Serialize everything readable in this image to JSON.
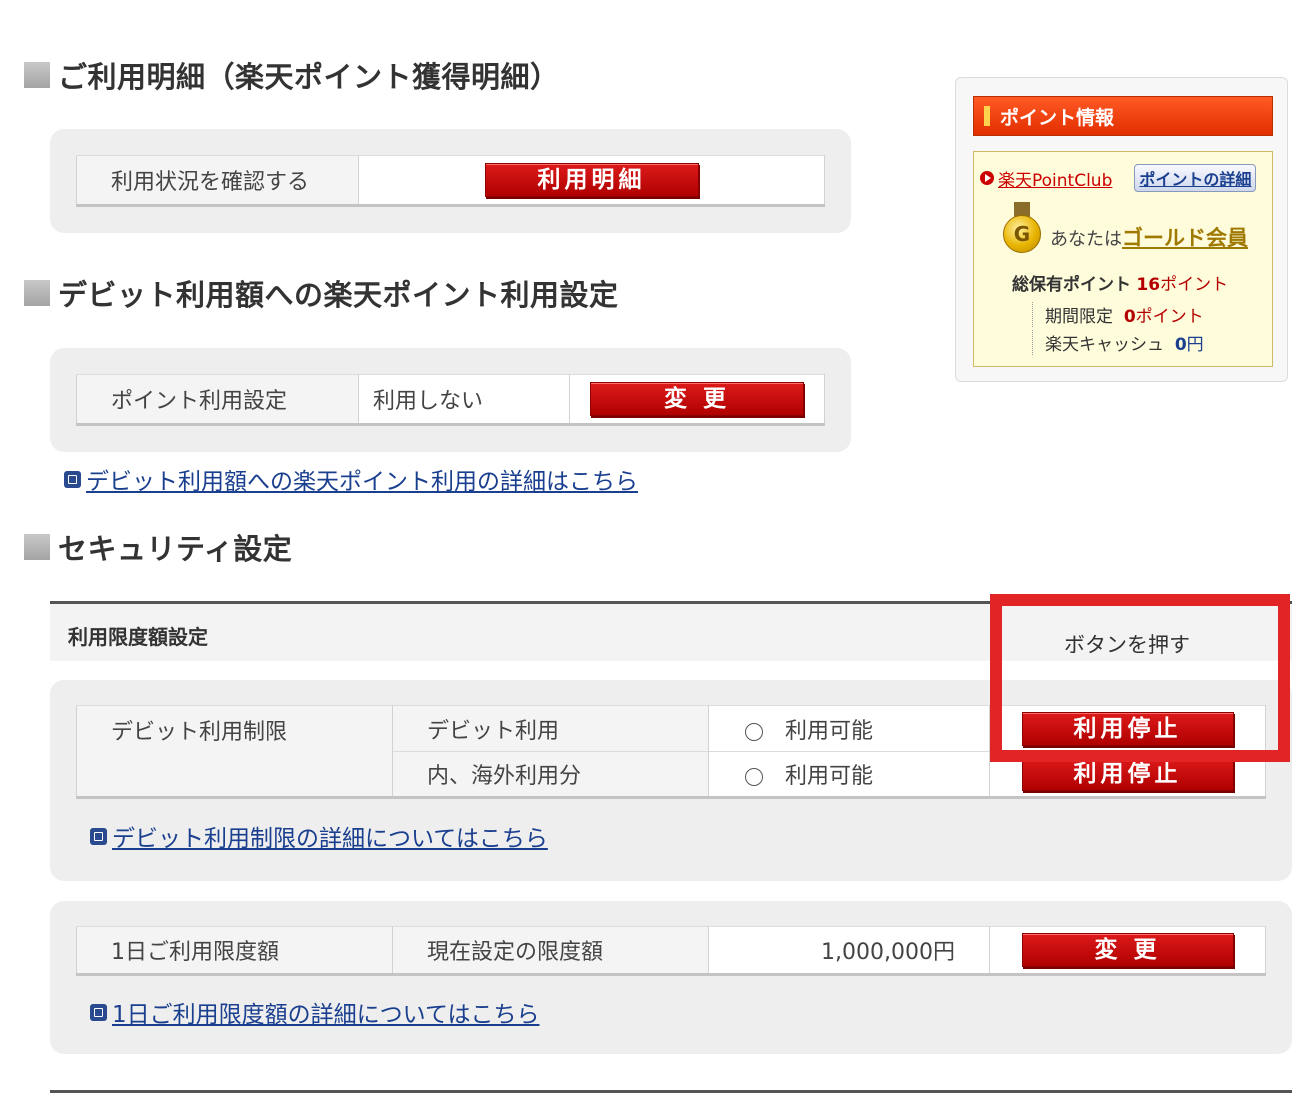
{
  "sections": {
    "usage": {
      "title": "ご利用明細（楽天ポイント獲得明細）",
      "label": "利用状況を確認する",
      "button": "利用明細"
    },
    "point_use": {
      "title": "デビット利用額への楽天ポイント利用設定",
      "label": "ポイント利用設定",
      "value": "利用しない",
      "button": "変 更",
      "link": "デビット利用額への楽天ポイント利用の詳細はこちら"
    },
    "security": {
      "title": "セキュリティ設定",
      "header_left": "利用限度額設定",
      "header_right": "ボタンを押す",
      "debit_limit": {
        "label": "デビット利用制限",
        "rows": [
          {
            "name": "デビット利用",
            "status": "利用可能",
            "button": "利用停止"
          },
          {
            "name": "内、海外利用分",
            "status": "利用可能",
            "button": "利用停止"
          }
        ],
        "link": "デビット利用制限の詳細についてはこちら"
      },
      "daily_limit": {
        "label": "1日ご利用限度額",
        "sublabel": "現在設定の限度額",
        "value": "1,000,000円",
        "button": "変 更",
        "link": "1日ご利用限度額の詳細についてはこちら"
      }
    }
  },
  "point_info": {
    "title": "ポイント情報",
    "club_link": "楽天PointClub",
    "detail_button": "ポイントの詳細",
    "medal_letter": "G",
    "member_prefix": "あなたは",
    "member_rank": "ゴールド会員",
    "total_label": "総保有ポイント",
    "total_value": "16",
    "total_unit": "ポイント",
    "limited_label": "期間限定",
    "limited_value": "0",
    "limited_unit": "ポイント",
    "cash_label": "楽天キャッシュ",
    "cash_value": "0",
    "cash_unit": "円"
  },
  "colors": {
    "button_red": "#c40000",
    "highlight_red": "#e32424",
    "point_header_orange": "#f04010",
    "link_blue": "#1a3f8f",
    "panel_gray": "#eeeeee"
  }
}
